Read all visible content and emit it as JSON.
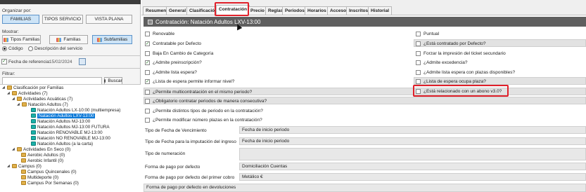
{
  "left": {
    "organizar_label": "Organizar por:",
    "org_buttons": [
      "FAMILIAS",
      "TIPOS SERVICIO",
      "VISTA PLANA"
    ],
    "mostrar_label": "Mostrar:",
    "show_buttons": [
      "Tipos Familias",
      "Familias",
      "Subfamilias"
    ],
    "radio_codigo": "Código",
    "radio_desc": "Descripción del servicio",
    "fecha_label": "Fecha de referencia:",
    "fecha_value": "15/02/2024",
    "filtrar_label": "Filtrar:",
    "buscar_label": "Buscar",
    "tree": [
      "Clasificación por Familias",
      "Actividades (7)",
      "Actividades Acuáticas (7)",
      "Natación Adultos (7)",
      "Natación Adultos LX-10:00 (multiempresa)",
      "Natación Adultos LXV-13:00",
      "Natación Adultos MJ-13:00",
      "Natación Adultos MJ-13:00 FUTURA",
      "Natación RENOVABLE MJ-13:00",
      "Natación NO RENOVABLE MJ-13:00",
      "Natación Adultos (a la carta)",
      "Actividades En Seco (0)",
      "Aerobic Adultos (0)",
      "Aerobic Infantil (0)",
      "Campus (0)",
      "Campus Quincenales (0)",
      "Multideporte (0)",
      "Campus Por Semanas (0)"
    ]
  },
  "tabs": [
    "Resumen",
    "General",
    "Clasificación",
    "Contratación",
    "Precio",
    "Reglas",
    "Periodos",
    "Horarios",
    "Acceso",
    "Inscritos",
    "Historial"
  ],
  "header_title": "Contratación: Natación Adultos LXV-13:00",
  "left_checks": [
    {
      "label": "Renovable",
      "checked": false
    },
    {
      "label": "Contratable por Defecto",
      "checked": true
    },
    {
      "label": "Baja En Cambio de Categoría",
      "checked": false
    },
    {
      "label": "¿Admite preinscripción?",
      "checked": true
    },
    {
      "label": "¿Admite lista espera?",
      "checked": false
    },
    {
      "label": "¿Lista de espera permite informar nivel?",
      "checked": true
    },
    {
      "label": "¿Permite multicontratación en el mismo periodo?",
      "checked": false
    },
    {
      "label": "¿Obligatorio contratar periodos de manera consecutiva?",
      "checked": false
    },
    {
      "label": "¿Permite distintos tipos de periodo en la contratación?",
      "checked": false
    },
    {
      "label": "¿Permite modificar número plazas en la contratación?",
      "checked": false
    }
  ],
  "right_checks": [
    {
      "label": "Puntual",
      "checked": false
    },
    {
      "label": "¿Está contratado por Defecto?",
      "checked": false
    },
    {
      "label": "Forzar la impresión del ticket secundario",
      "checked": false
    },
    {
      "label": "¿Admite excedencia?",
      "checked": false
    },
    {
      "label": "¿Admite lista espera con plazas disponibles?",
      "checked": false
    },
    {
      "label": "¿Lista de espera ocupa plaza?",
      "checked": false
    },
    {
      "label": "¿Está relacionado con un abono v3.0?",
      "checked": false
    }
  ],
  "form": [
    {
      "label": "Tipo de Fecha de Vencimiento",
      "value": "Fecha de inicio periodo"
    },
    {
      "label": "Tipo de Fecha para la imputación del ingreso",
      "value": "Fecha de inicio periodo"
    },
    {
      "label": "Tipo de numeración",
      "value": ""
    },
    {
      "label": "Forma de pago por defecto",
      "value": "Domiciliación Cuentas"
    },
    {
      "label": "Forma de pago por defecto del primer cobro",
      "value": "Metálico €"
    },
    {
      "label": "Forma de pago por defecto en devoluciones",
      "value": ""
    }
  ]
}
